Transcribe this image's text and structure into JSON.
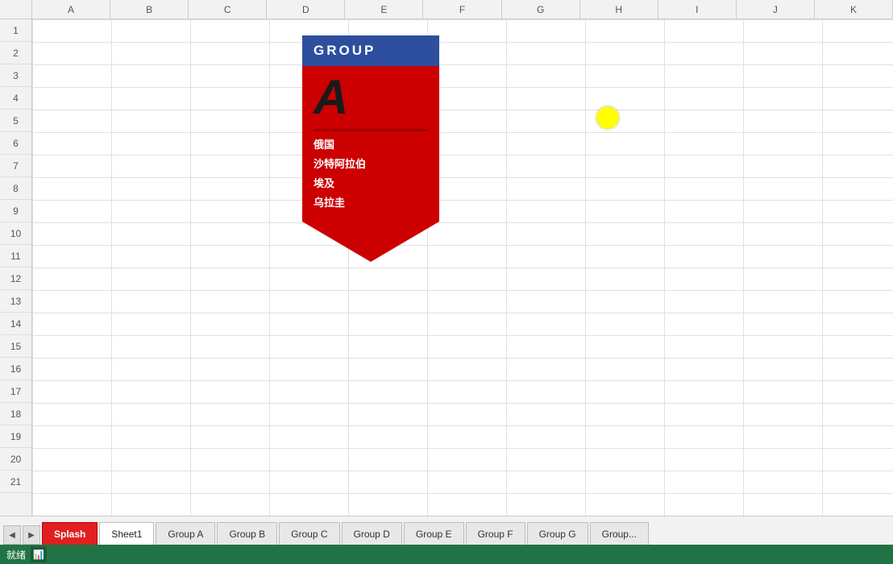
{
  "spreadsheet": {
    "columns": [
      "A",
      "B",
      "C",
      "D",
      "E",
      "F",
      "G",
      "H",
      "I",
      "J",
      "K"
    ],
    "rows": [
      1,
      2,
      3,
      4,
      5,
      6,
      7,
      8,
      9,
      10,
      11,
      12,
      13,
      14,
      15,
      16,
      17,
      18,
      19,
      20,
      21
    ],
    "bookmark": {
      "header": "GROUP",
      "letter": "A",
      "teams": [
        "俄国",
        "沙特阿拉伯",
        "埃及",
        "乌拉圭"
      ]
    },
    "tabs": [
      {
        "label": "Splash",
        "state": "active-red"
      },
      {
        "label": "Sheet1",
        "state": "active-white"
      },
      {
        "label": "Group A",
        "state": "normal"
      },
      {
        "label": "Group B",
        "state": "normal"
      },
      {
        "label": "Group C",
        "state": "normal"
      },
      {
        "label": "Group D",
        "state": "normal"
      },
      {
        "label": "Group E",
        "state": "normal"
      },
      {
        "label": "Group F",
        "state": "normal"
      },
      {
        "label": "Group G",
        "state": "normal"
      },
      {
        "label": "Group...",
        "state": "normal"
      }
    ],
    "status": "就绪"
  }
}
